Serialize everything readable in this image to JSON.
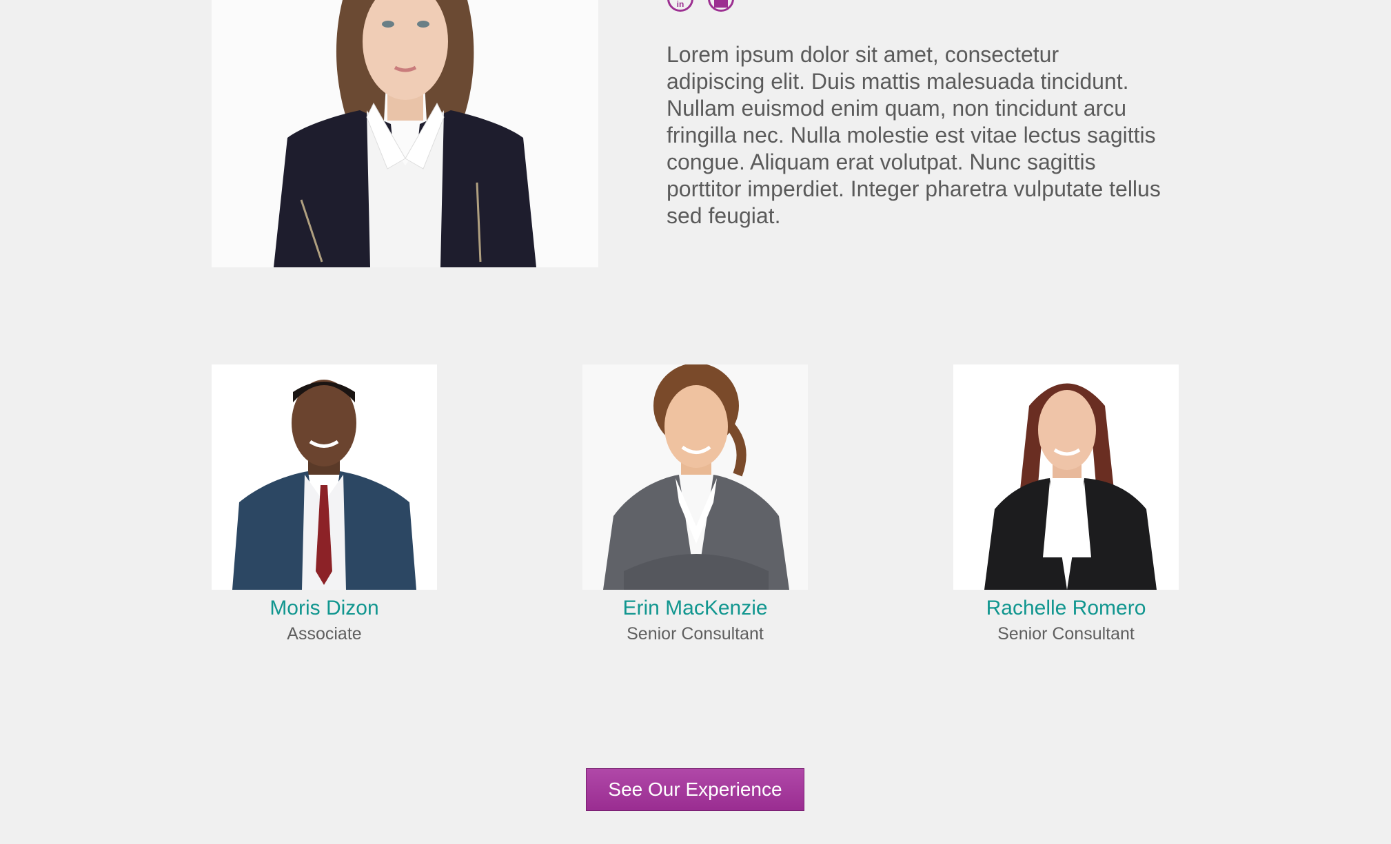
{
  "featured": {
    "bio": "Lorem ipsum dolor sit amet, consectetur adipiscing elit. Duis mattis malesuada tincidunt. Nullam euismod enim quam, non tincidunt arcu fringilla nec. Nulla molestie est vitae lectus sagittis congue. Aliquam erat volutpat. Nunc sagittis porttitor imperdiet. Integer pharetra vulputate tellus sed feugiat.",
    "social_icons": [
      "linkedin-icon",
      "email-icon"
    ]
  },
  "team": [
    {
      "name": "Moris Dizon",
      "role": "Associate"
    },
    {
      "name": "Erin MacKenzie",
      "role": "Senior Consultant"
    },
    {
      "name": "Rachelle Romero",
      "role": "Senior Consultant"
    }
  ],
  "cta": {
    "label": "See Our Experience"
  },
  "colors": {
    "accent": "#9c2f91",
    "name": "#11968f",
    "text": "#5a5a5a",
    "background": "#f0f0f0"
  }
}
